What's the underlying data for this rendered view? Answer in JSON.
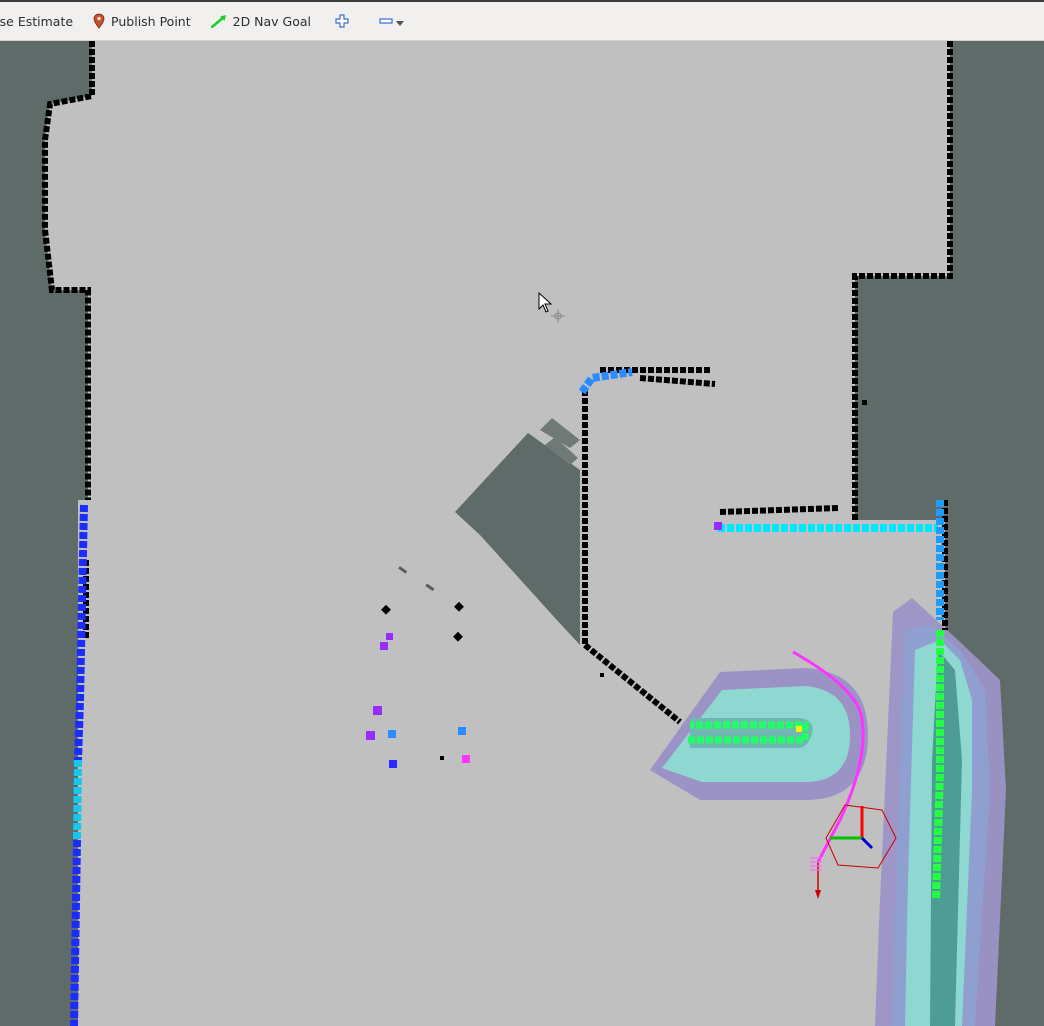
{
  "toolbar": {
    "tools": [
      {
        "label": "ose Estimate",
        "icon": "pose-estimate-icon"
      },
      {
        "label": "Publish Point",
        "icon": "map-pin-icon"
      },
      {
        "label": "2D Nav Goal",
        "icon": "nav-goal-arrow-icon"
      }
    ],
    "add_tool_icon": "plus-icon",
    "remove_tool_icon": "minus-icon",
    "dropdown_icon": "dropdown-arrow-icon"
  },
  "colors": {
    "toolbar_bg": "#f1f0ee",
    "unknown_space": "#5f6b69",
    "free_space": "#c0c0c0",
    "obstacle": "#000000",
    "costmap_inner": "#8fd8d2",
    "costmap_outer": "#9b93c6",
    "path": "#ff33ff",
    "robot_footprint": "#cc0000",
    "scan_blue": "#1a2cff",
    "scan_cyan": "#00f0ff",
    "scan_green": "#22ff44",
    "scan_purple": "#9a2bff"
  },
  "viewport": {
    "cursor_icon": "mouse-pointer-icon",
    "move_cursor_icon": "move-cursor-icon",
    "robot_axes_icon": "robot-frame-axes-icon"
  }
}
